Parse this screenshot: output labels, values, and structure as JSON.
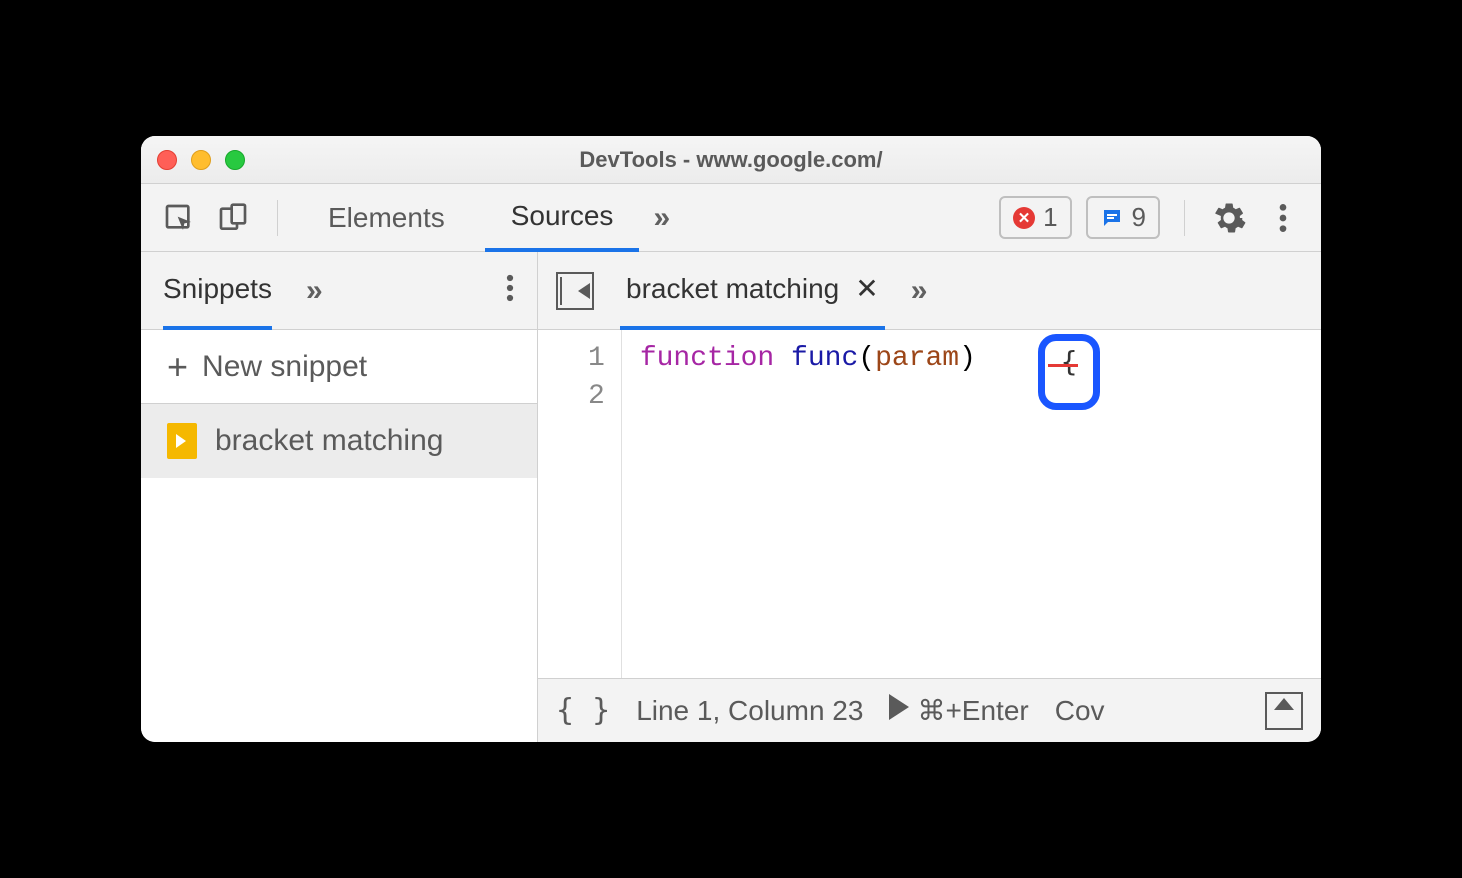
{
  "window": {
    "title": "DevTools - www.google.com/"
  },
  "tabs": {
    "elements": "Elements",
    "sources": "Sources"
  },
  "badges": {
    "errors": "1",
    "messages": "9"
  },
  "sidebar": {
    "tab": "Snippets",
    "new_snippet": "New snippet",
    "items": [
      {
        "name": "bracket matching"
      }
    ]
  },
  "editor": {
    "tab_name": "bracket matching",
    "lines": [
      "1",
      "2"
    ],
    "tokens": {
      "kw": "function",
      "fn": "func",
      "lp": "(",
      "prm": "param",
      "rp": ")",
      "sp": " ",
      "brace": "{"
    }
  },
  "status": {
    "position": "Line 1, Column 23",
    "run_hint": "⌘+Enter",
    "coverage": "Cov"
  }
}
